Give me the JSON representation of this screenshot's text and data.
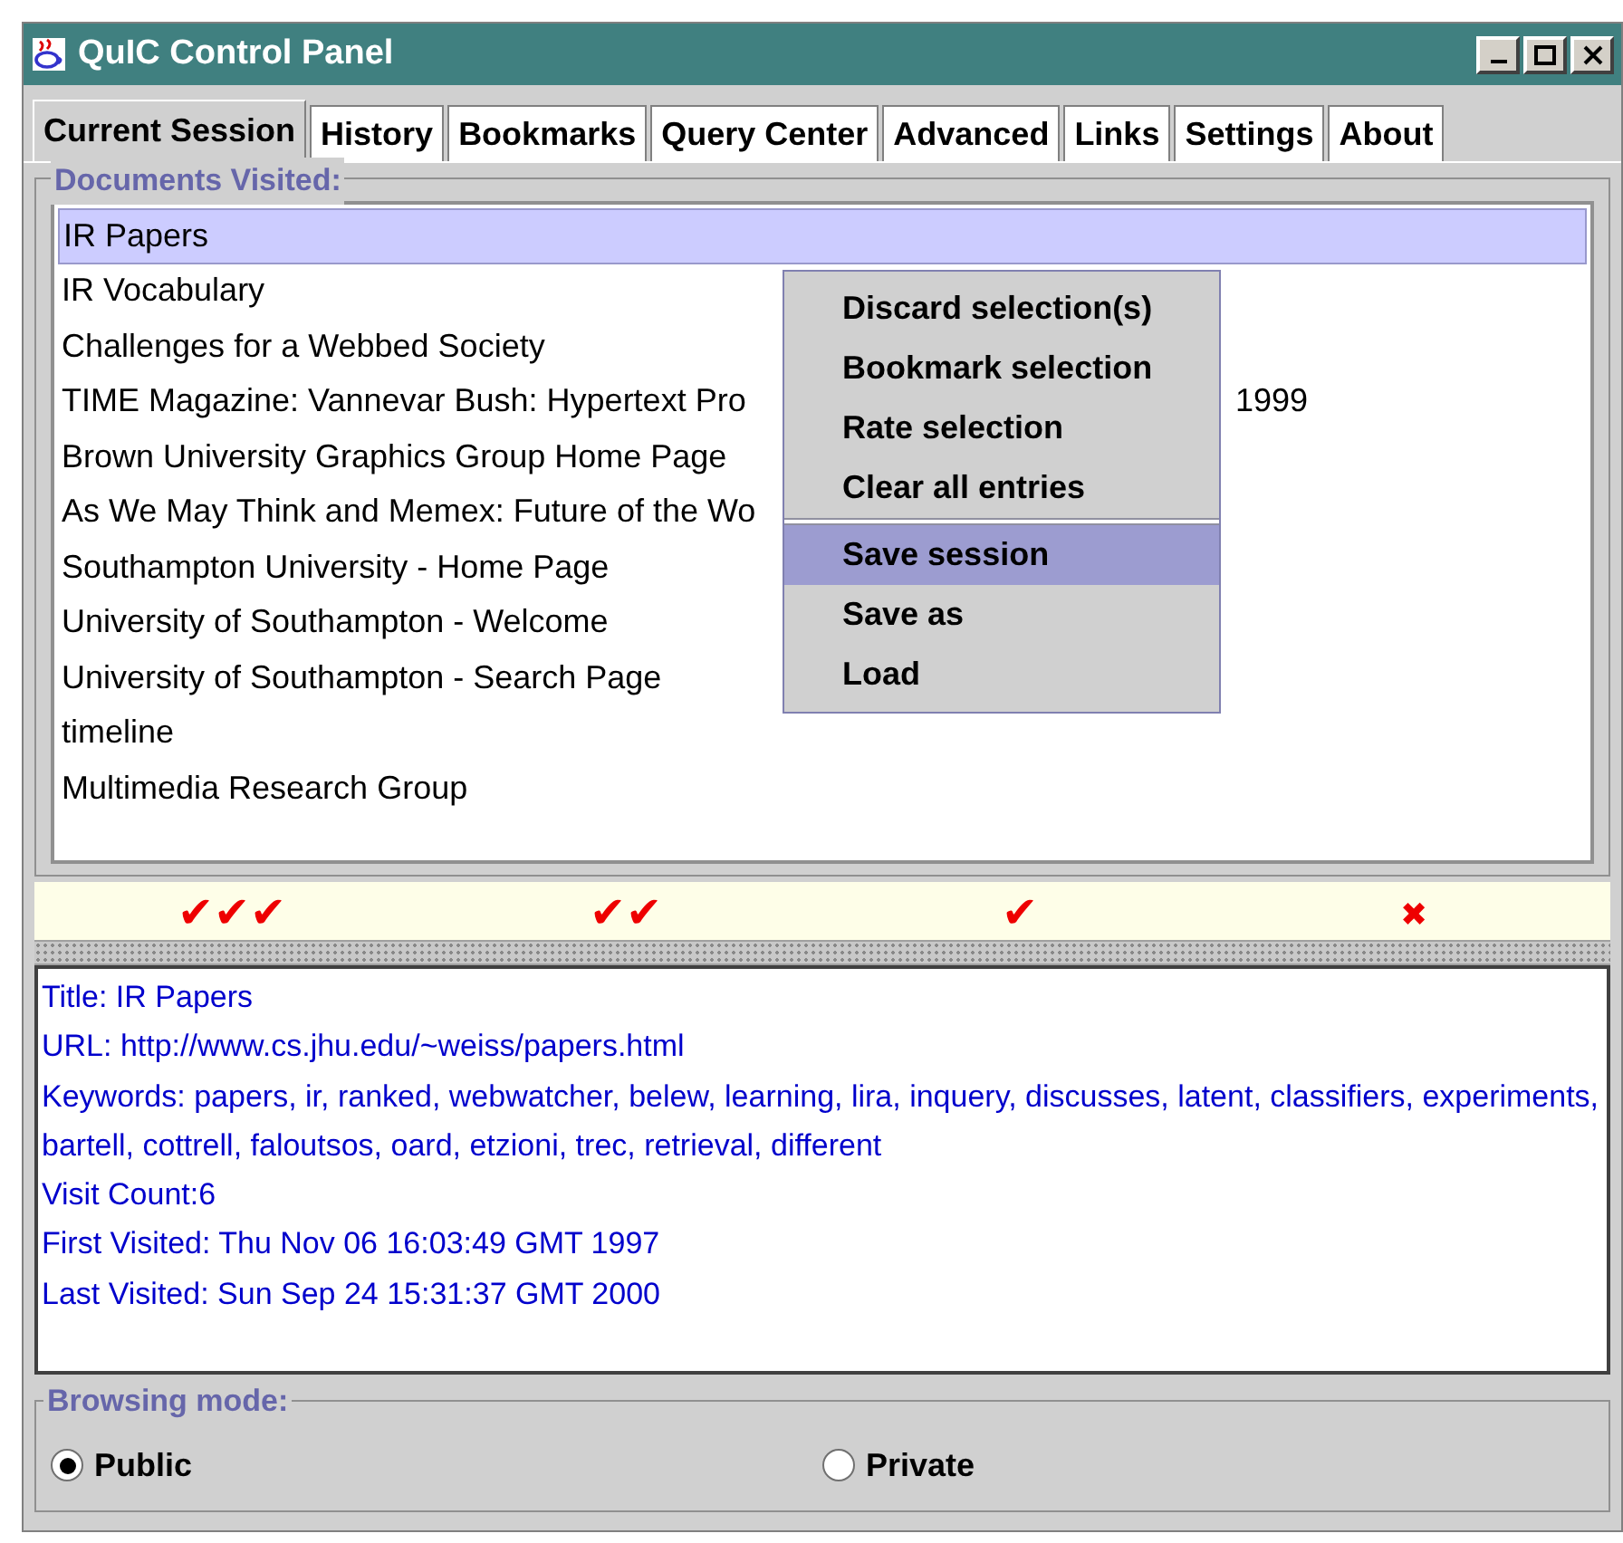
{
  "window": {
    "title": "QuIC Control Panel"
  },
  "tabs": [
    {
      "label": "Current Session",
      "selected": true
    },
    {
      "label": "History",
      "selected": false
    },
    {
      "label": "Bookmarks",
      "selected": false
    },
    {
      "label": "Query Center",
      "selected": false
    },
    {
      "label": "Advanced",
      "selected": false
    },
    {
      "label": "Links",
      "selected": false
    },
    {
      "label": "Settings",
      "selected": false
    },
    {
      "label": "About",
      "selected": false
    }
  ],
  "documents": {
    "legend": "Documents Visited:",
    "items": [
      {
        "text": "IR Papers",
        "selected": true
      },
      {
        "text": "IR Vocabulary",
        "selected": false
      },
      {
        "text": "Challenges for a Webbed Society",
        "selected": false
      },
      {
        "text": "TIME Magazine: Vannevar Bush: Hypertext Pro",
        "text_after": "1999",
        "selected": false
      },
      {
        "text": "Brown University Graphics Group Home Page",
        "selected": false
      },
      {
        "text": "As We May Think and Memex: Future of the Wo",
        "selected": false
      },
      {
        "text": "Southampton University - Home Page",
        "selected": false
      },
      {
        "text": "University of Southampton - Welcome",
        "selected": false
      },
      {
        "text": "University of Southampton - Search Page",
        "selected": false
      },
      {
        "text": "timeline",
        "selected": false
      },
      {
        "text": "Multimedia Research Group",
        "selected": false
      }
    ]
  },
  "context_menu": {
    "sections": [
      [
        {
          "label": "Discard selection(s)",
          "selected": false
        },
        {
          "label": "Bookmark selection",
          "selected": false
        },
        {
          "label": "Rate selection",
          "selected": false
        },
        {
          "label": "Clear all entries",
          "selected": false
        }
      ],
      [
        {
          "label": "Save session",
          "selected": true
        },
        {
          "label": "Save as",
          "selected": false
        },
        {
          "label": "Load",
          "selected": false
        }
      ]
    ]
  },
  "ratings": [
    {
      "kind": "check",
      "marks": "✔✔✔"
    },
    {
      "kind": "check",
      "marks": "✔✔"
    },
    {
      "kind": "check",
      "marks": "✔"
    },
    {
      "kind": "cross",
      "marks": "✖"
    }
  ],
  "details": [
    "Title: IR Papers",
    "URL: http://www.cs.jhu.edu/~weiss/papers.html",
    "Keywords: papers, ir, ranked, webwatcher, belew, learning, lira, inquery, discusses, latent, classifiers, experiments, bartell, cottrell, faloutsos, oard, etzioni, trec, retrieval, different",
    "Visit Count:6",
    "First Visited: Thu Nov 06 16:03:49 GMT 1997",
    "Last Visited: Sun Sep 24 15:31:37 GMT 2000"
  ],
  "browsing_mode": {
    "legend": "Browsing mode:",
    "options": [
      {
        "label": "Public",
        "selected": true
      },
      {
        "label": "Private",
        "selected": false
      }
    ]
  }
}
